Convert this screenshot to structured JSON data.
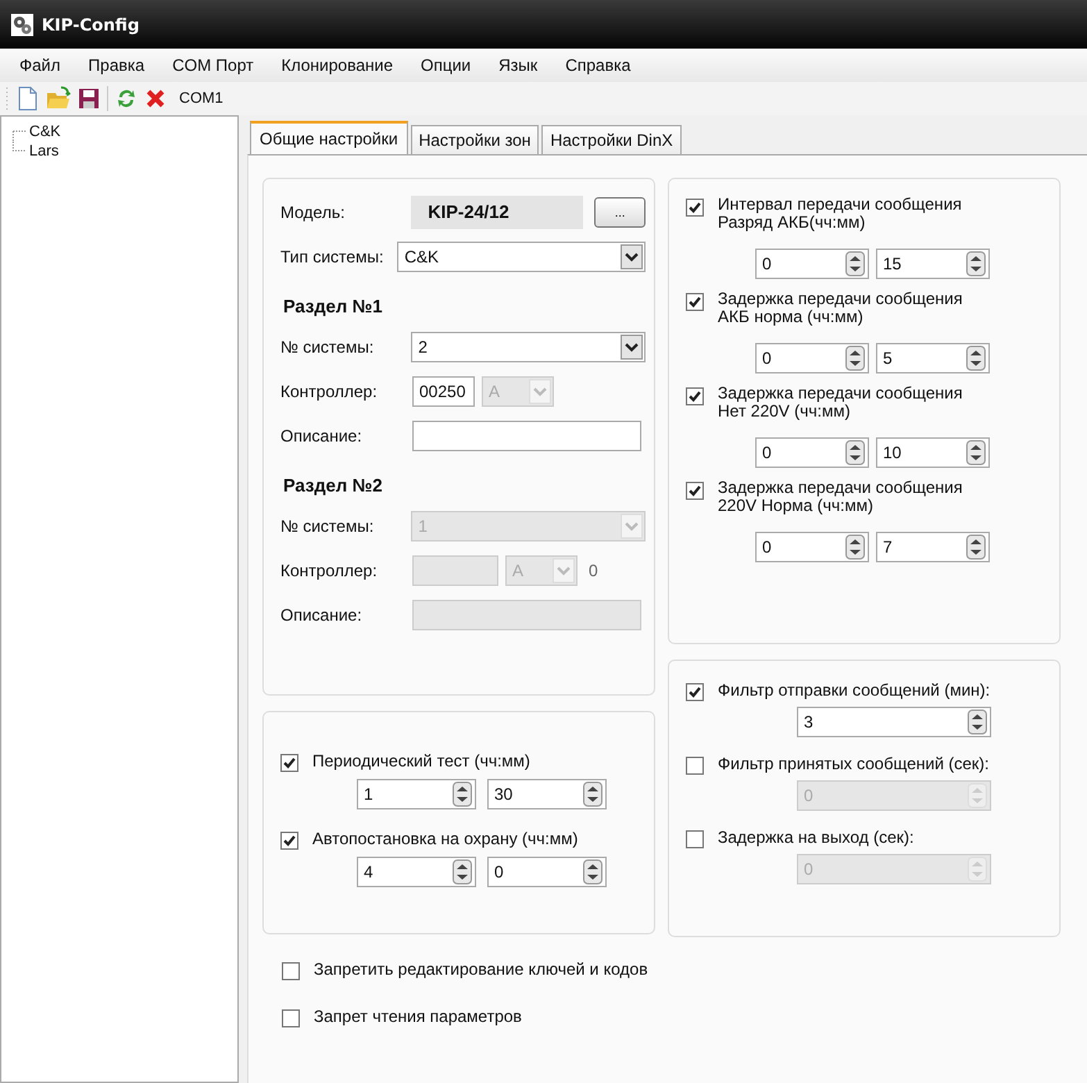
{
  "window": {
    "title": "KIP-Config"
  },
  "menu": [
    "Файл",
    "Правка",
    "COM Порт",
    "Клонирование",
    "Опции",
    "Язык",
    "Справка"
  ],
  "toolbar": {
    "port": "COM1"
  },
  "tree": [
    {
      "label": "C&K"
    },
    {
      "label": "Lars"
    }
  ],
  "tabs": [
    {
      "label": "Общие настройки",
      "selected": true
    },
    {
      "label": "Настройки зон",
      "selected": false
    },
    {
      "label": "Настройки DinX",
      "selected": false
    }
  ],
  "model": {
    "label": "Модель:",
    "value": "KIP-24/12",
    "button": "..."
  },
  "system_type": {
    "label": "Тип системы:",
    "value": "C&K"
  },
  "sections": [
    {
      "title": "Раздел №1",
      "disabled": false,
      "system_label": "№ системы:",
      "system_value": "2",
      "controller_label": "Контроллер:",
      "controller_value": "00250",
      "letter": "A",
      "description_label": "Описание:"
    },
    {
      "title": "Раздел №2",
      "disabled": true,
      "system_label": "№ системы:",
      "system_value": "1",
      "controller_label": "Контроллер:",
      "letter": "A",
      "suffix": "0",
      "description_label": "Описание:"
    }
  ],
  "timers": [
    {
      "label": "Интервал передачи сообщения\nРазряд АКБ(чч:мм)",
      "checked": true,
      "hours": "0",
      "minutes": "15"
    },
    {
      "label": "Задержка передачи сообщения\nАКБ норма (чч:мм)",
      "checked": true,
      "hours": "0",
      "minutes": "5"
    },
    {
      "label": "Задержка передачи сообщения\nНет 220V (чч:мм)",
      "checked": true,
      "hours": "0",
      "minutes": "10"
    },
    {
      "label": "Задержка передачи сообщения\n220V Норма (чч:мм)",
      "checked": true,
      "hours": "0",
      "minutes": "7"
    }
  ],
  "periodic": [
    {
      "label": "Периодический тест (чч:мм)",
      "checked": true,
      "hours": "1",
      "minutes": "30"
    },
    {
      "label": "Автопостановка на охрану  (чч:мм)",
      "checked": true,
      "hours": "4",
      "minutes": "0"
    }
  ],
  "filters": [
    {
      "label": "Фильтр отправки сообщений (мин):",
      "checked": true,
      "value": "3"
    },
    {
      "label": "Фильтр принятых сообщений (сек):",
      "checked": false,
      "value": "0"
    },
    {
      "label": "Задержка на выход (сек):",
      "checked": false,
      "value": "0"
    }
  ],
  "options": [
    {
      "label": "Запретить редактирование ключей и кодов",
      "checked": false
    },
    {
      "label": "Запрет чтения параметров",
      "checked": false
    }
  ]
}
